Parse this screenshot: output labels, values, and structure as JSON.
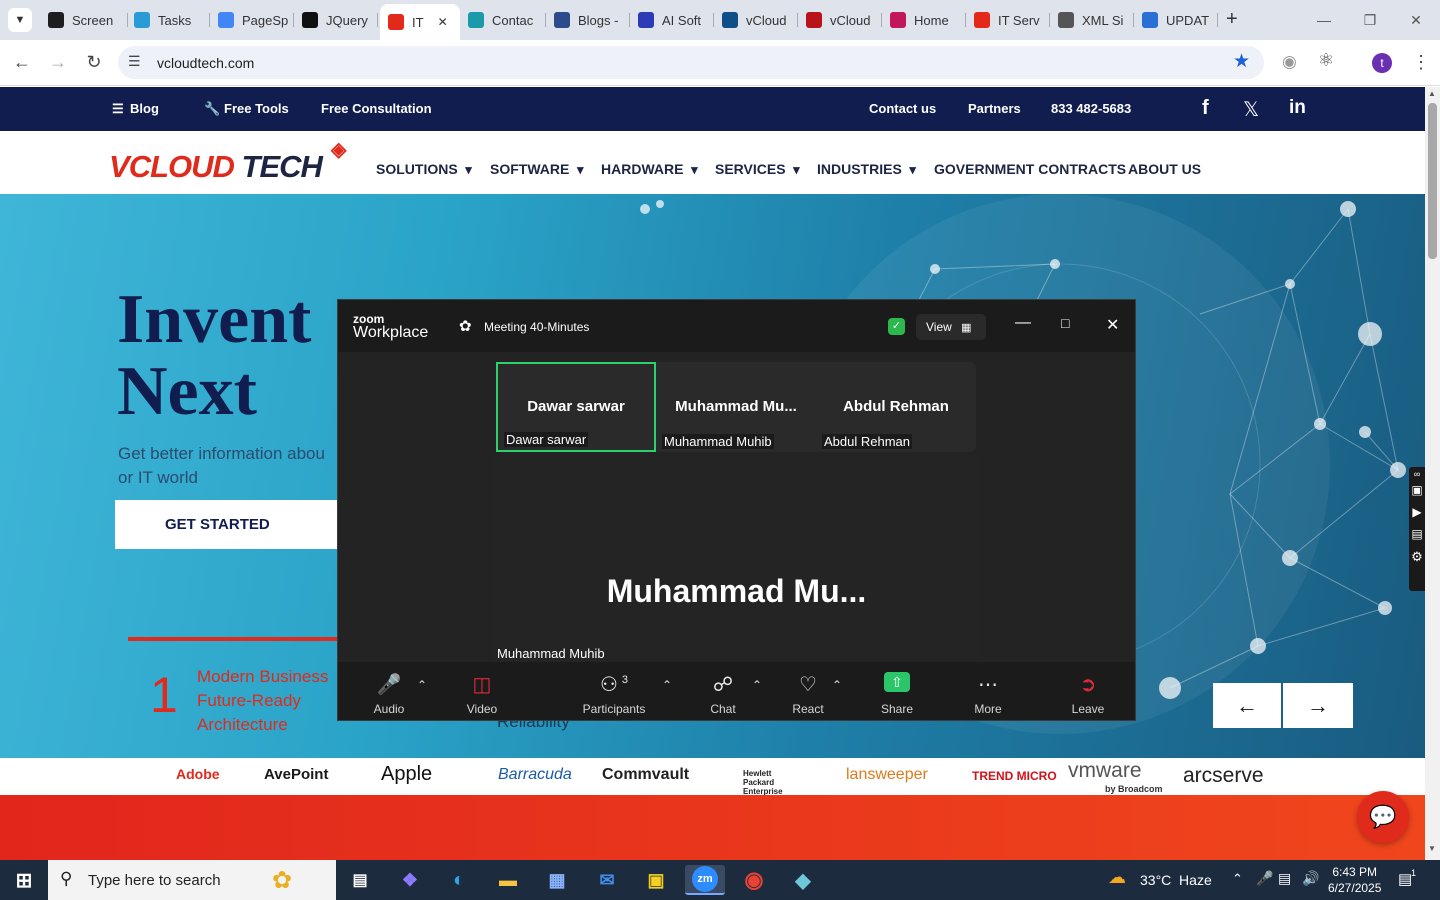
{
  "browser": {
    "tabs": [
      {
        "label": "Screen",
        "icon": "screencast-icon",
        "color": "#1e1e1e"
      },
      {
        "label": "Tasks",
        "icon": "tasks-icon",
        "color": "#2b9bd6"
      },
      {
        "label": "PageSp",
        "icon": "pagespeed-icon",
        "color": "#4285f4"
      },
      {
        "label": "JQuery",
        "icon": "openai-icon",
        "color": "#111111"
      },
      {
        "label": "IT",
        "icon": "vcloud-diamond-icon",
        "color": "#e32a1a",
        "active": true
      },
      {
        "label": "Contac",
        "icon": "wordpress-icon",
        "color": "#1b9aaa"
      },
      {
        "label": "Blogs -",
        "icon": "tool-icon",
        "color": "#2d4a8a"
      },
      {
        "label": "AI Soft",
        "icon": "x-logo-icon",
        "color": "#2d3ab8"
      },
      {
        "label": "vCloud",
        "icon": "vcloud-check-icon",
        "color": "#0e4f8a"
      },
      {
        "label": "vCloud",
        "icon": "vcloud-v-icon",
        "color": "#b8121a"
      },
      {
        "label": "Home",
        "icon": "asana-icon",
        "color": "#c2185b"
      },
      {
        "label": "IT Serv",
        "icon": "vcloud-diamond-icon",
        "color": "#e32a1a"
      },
      {
        "label": "XML Si",
        "icon": "globe-icon",
        "color": "#555555"
      },
      {
        "label": "UPDAT",
        "icon": "docs-icon",
        "color": "#2a6fd6"
      }
    ],
    "new_tab": "+",
    "url": "vcloudtech.com"
  },
  "site": {
    "topnav": {
      "blog": "Blog",
      "free_tools": "Free Tools",
      "free_consultation": "Free Consultation",
      "contact": "Contact us",
      "partners": "Partners",
      "phone": "833 482-5683"
    },
    "logo": {
      "text_red": "V",
      "text_red2": "CLOUD",
      "text_dark": "TECH"
    },
    "mainnav": [
      "SOLUTIONS",
      "SOFTWARE",
      "HARDWARE",
      "SERVICES",
      "INDUSTRIES",
      "GOVERNMENT CONTRACTS",
      "ABOUT US"
    ],
    "hero": {
      "title_line1": "Invent",
      "title_line2": "Next",
      "subtitle_line1": "Get better information abou",
      "subtitle_line2": "or IT world",
      "cta": "GET STARTED",
      "step_number": "1",
      "step_text_line1": "Modern Business",
      "step_text_line2": "Future-Ready",
      "step_text_line3": "Architecture",
      "reliability": "Reliability"
    },
    "brands": [
      "Adobe",
      "AvePoint",
      "Apple",
      "Barracuda",
      "Commvault",
      "Hewlett Packard Enterprise",
      "lansweeper",
      "TREND MICRO",
      "vmware",
      "arcserve"
    ],
    "brands_sub": "by Broadcom"
  },
  "zoom": {
    "app_name_small": "zoom",
    "app_name": "Workplace",
    "meeting_title": "Meeting 40-Minutes",
    "view_label": "View",
    "participants": [
      {
        "display": "Dawar sarwar",
        "label": "Dawar sarwar",
        "active": true
      },
      {
        "display": "Muhammad  Mu...",
        "label": "Muhammad Muhib"
      },
      {
        "display": "Abdul Rehman",
        "label": "Abdul Rehman"
      }
    ],
    "speaker": {
      "display": "Muhammad  Mu...",
      "label": "Muhammad Muhib"
    },
    "toolbar": {
      "audio": "Audio",
      "video": "Video",
      "participants": "Participants",
      "participant_count": "3",
      "chat": "Chat",
      "react": "React",
      "share": "Share",
      "more": "More",
      "leave": "Leave"
    }
  },
  "taskbar": {
    "search_placeholder": "Type here to search",
    "weather": "33°C  Haze",
    "time": "6:43 PM",
    "date": "6/27/2025",
    "notification_count": "1",
    "zoom_label": "zm"
  }
}
